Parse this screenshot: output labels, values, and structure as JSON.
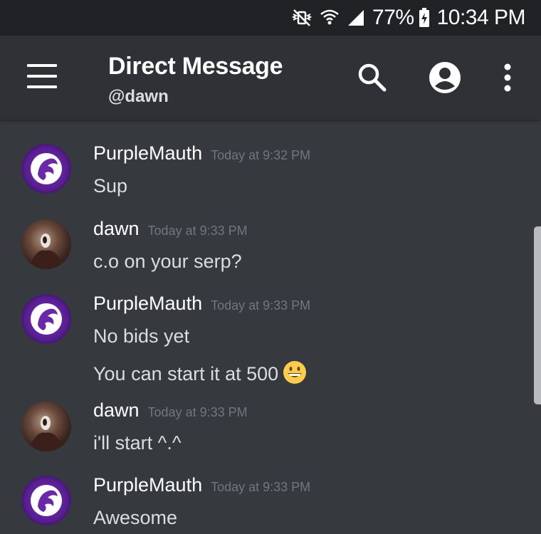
{
  "status_bar": {
    "battery_percent": "77%",
    "time": "10:34 PM",
    "icons": [
      "vibrate-mute-icon",
      "wifi-icon",
      "signal-icon",
      "battery-charging-icon"
    ]
  },
  "header": {
    "title": "Direct Message",
    "subtitle": "@dawn",
    "icons": [
      "menu-icon",
      "search-icon",
      "profile-icon",
      "more-vert-icon"
    ]
  },
  "messages": [
    {
      "author": "PurpleMauth",
      "timestamp": "Today at 9:32 PM",
      "lines": [
        "Sup"
      ]
    },
    {
      "author": "dawn",
      "timestamp": "Today at 9:33 PM",
      "lines": [
        "c.o on your serp?"
      ]
    },
    {
      "author": "PurpleMauth",
      "timestamp": "Today at 9:33 PM",
      "lines": [
        "No bids yet",
        "You can start it at 500"
      ],
      "emoji": "grinning-face-emoji"
    },
    {
      "author": "dawn",
      "timestamp": "Today at 9:33 PM",
      "lines": [
        "i'll start ^.^"
      ]
    },
    {
      "author": "PurpleMauth",
      "timestamp": "Today at 9:33 PM",
      "lines": [
        "Awesome"
      ]
    }
  ],
  "colors": {
    "background": "#36393e",
    "header": "#2f3136",
    "status_bar": "#202225",
    "timestamp": "#72767d",
    "avatar_purple": "#5b1f95"
  }
}
